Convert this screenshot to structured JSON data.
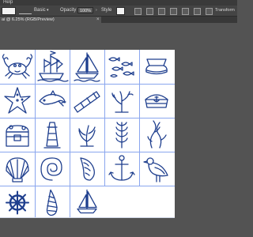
{
  "menubar": {
    "help_label": "Help"
  },
  "controlbar": {
    "basic_label": "Basic",
    "opacity_label": "Opacity",
    "opacity_value": "100%",
    "style_label": "Style",
    "transform_label": "Transform"
  },
  "document_tab": {
    "title": "ai @ 6.25% (RGB/Preview)",
    "close_glyph": "×"
  },
  "icons": [
    [
      "crab",
      "pirate-ship",
      "sailboat",
      "fish-school",
      "sailor-hat-round"
    ],
    [
      "starfish",
      "dolphin",
      "spyglass",
      "coral",
      "sailor-cap-anchor"
    ],
    [
      "treasure-chest",
      "lighthouse",
      "seaweed-bush",
      "seaweed-sprig",
      "kelp"
    ],
    [
      "scallop-shell",
      "nautilus-shell",
      "conch-shell",
      "anchor",
      "seagull"
    ],
    [
      "ship-wheel",
      "auger-shell",
      "small-sailboat"
    ]
  ],
  "colors": {
    "line_art": "#1f3f8e",
    "selection": "#3f6cff",
    "workspace": "#535353"
  }
}
